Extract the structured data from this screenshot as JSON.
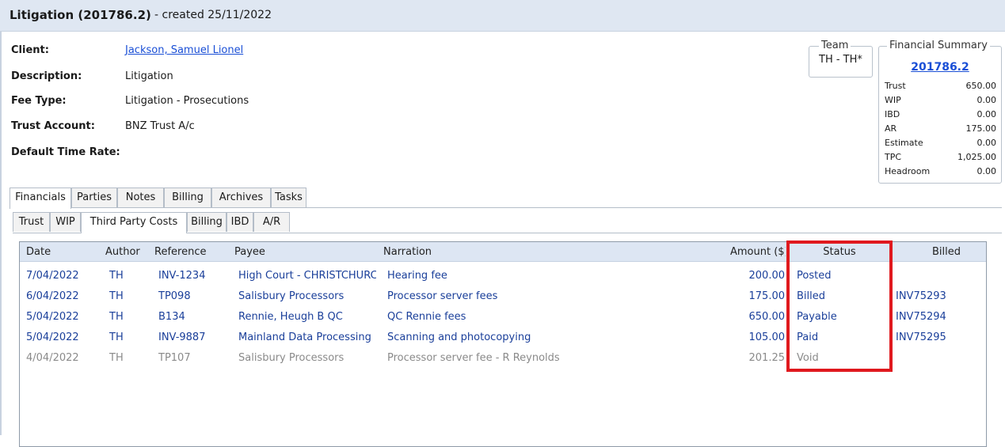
{
  "header": {
    "title": "Litigation (201786.2)",
    "created": "- created 25/11/2022"
  },
  "details": {
    "client_label": "Client:",
    "client_value": "Jackson, Samuel Lionel",
    "description_label": "Description:",
    "description_value": "Litigation",
    "fee_type_label": "Fee Type:",
    "fee_type_value": "Litigation - Prosecutions",
    "trust_account_label": "Trust Account:",
    "trust_account_value": "BNZ Trust A/c",
    "default_time_rate_label": "Default Time Rate:"
  },
  "team": {
    "legend": "Team",
    "value": "TH - TH*"
  },
  "financial_summary": {
    "legend": "Financial Summary",
    "matter_link": "201786.2",
    "rows": [
      {
        "label": "Trust",
        "value": "650.00"
      },
      {
        "label": "WIP",
        "value": "0.00"
      },
      {
        "label": "IBD",
        "value": "0.00"
      },
      {
        "label": "AR",
        "value": "175.00"
      },
      {
        "label": "Estimate",
        "value": "0.00"
      },
      {
        "label": "TPC",
        "value": "1,025.00"
      },
      {
        "label": "Headroom",
        "value": "0.00"
      }
    ]
  },
  "main_tabs": [
    "Financials",
    "Parties",
    "Notes",
    "Billing",
    "Archives",
    "Tasks"
  ],
  "main_tab_selected": "Financials",
  "sub_tabs": [
    "Trust",
    "WIP",
    "Third Party Costs",
    "Billing",
    "IBD",
    "A/R"
  ],
  "sub_tab_selected": "Third Party Costs",
  "grid": {
    "columns": [
      "Date",
      "Author",
      "Reference",
      "Payee",
      "Narration",
      "Amount ($)",
      "Status",
      "Billed"
    ],
    "rows": [
      {
        "date": "7/04/2022",
        "author": "TH",
        "reference": "INV-1234",
        "payee": "High Court - CHRISTCHURCH",
        "narration": "Hearing fee",
        "amount": "200.00",
        "status": "Posted",
        "billed": ""
      },
      {
        "date": "6/04/2022",
        "author": "TH",
        "reference": "TP098",
        "payee": "Salisbury Processors",
        "narration": "Processor server fees",
        "amount": "175.00",
        "status": "Billed",
        "billed": "INV75293"
      },
      {
        "date": "5/04/2022",
        "author": "TH",
        "reference": "B134",
        "payee": "Rennie, Heugh B QC",
        "narration": "QC Rennie fees",
        "amount": "650.00",
        "status": "Payable",
        "billed": "INV75294"
      },
      {
        "date": "5/04/2022",
        "author": "TH",
        "reference": "INV-9887",
        "payee": "Mainland Data Processing",
        "narration": "Scanning and photocopying",
        "amount": "105.00",
        "status": "Paid",
        "billed": "INV75295"
      },
      {
        "date": "4/04/2022",
        "author": "TH",
        "reference": "TP107",
        "payee": "Salisbury Processors",
        "narration": "Processor server fee - R Reynolds",
        "amount": "201.25",
        "status": "Void",
        "billed": ""
      }
    ]
  },
  "colors": {
    "active_row_text": "#1a3f9a",
    "void_row_text": "#8a8a8a",
    "link": "#1a4fd6",
    "highlight_border": "#e0191e",
    "header_background": "#dfe7f2"
  }
}
